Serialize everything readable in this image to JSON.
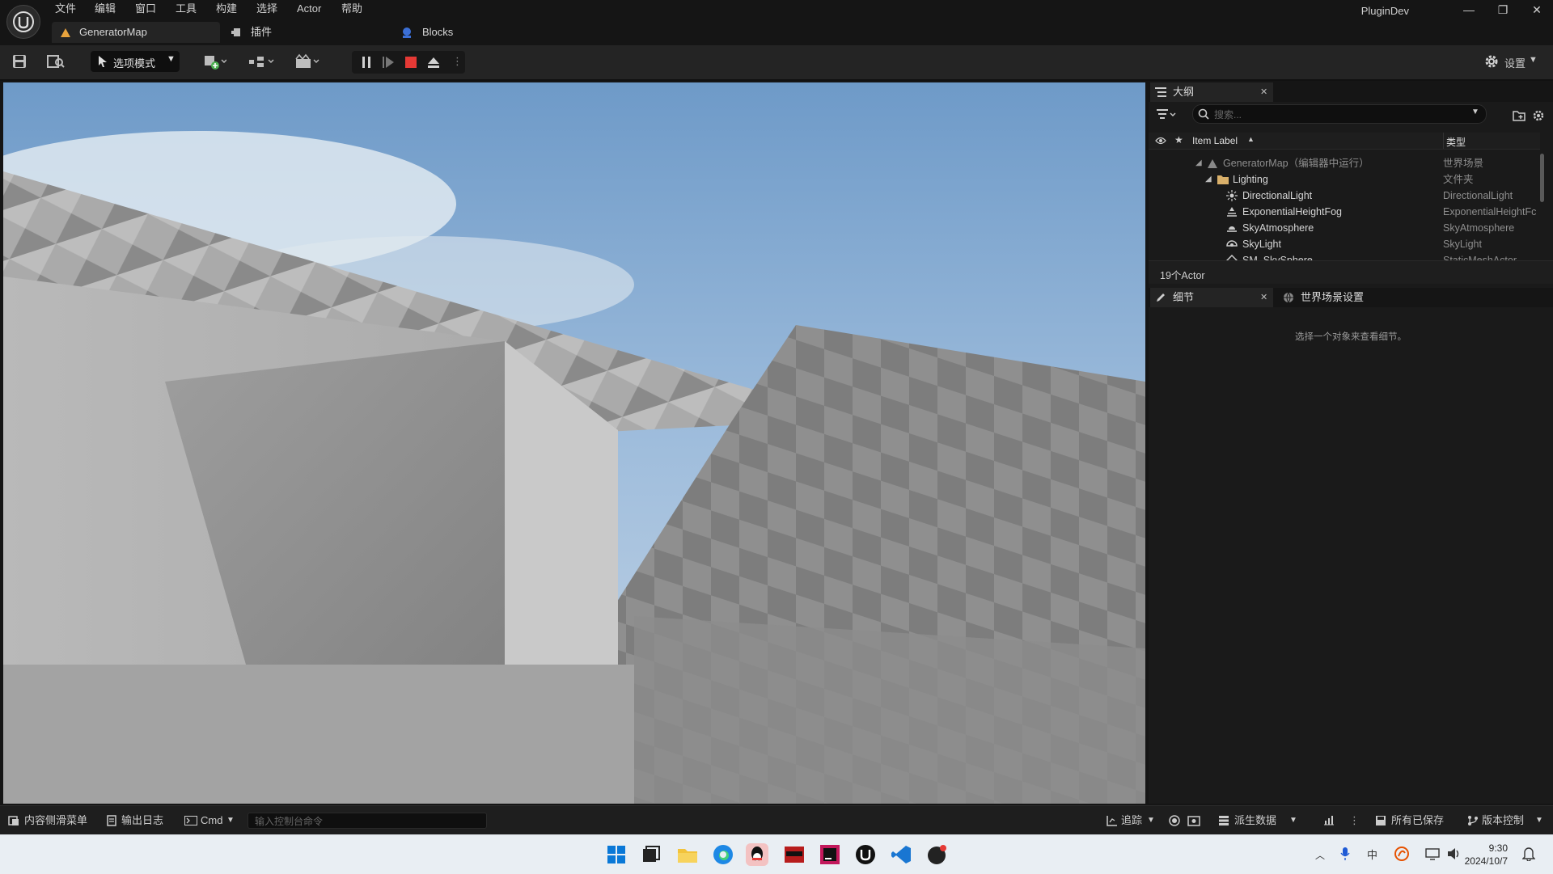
{
  "menu": [
    "文件",
    "编辑",
    "窗口",
    "工具",
    "构建",
    "选择",
    "Actor",
    "帮助"
  ],
  "tabs": {
    "main": "GeneratorMap",
    "plugins": "插件",
    "blocks": "Blocks"
  },
  "project_name": "PluginDev",
  "toolbar": {
    "mode_label": "选项模式",
    "settings_label": "设置"
  },
  "outliner": {
    "title": "大纲",
    "search_placeholder": "搜索...",
    "col_label": "Item Label",
    "col_type": "类型",
    "rows": [
      {
        "label": "GeneratorMap（编辑器中运行）",
        "type": "世界场景",
        "icon": "world-icon"
      },
      {
        "label": "Lighting",
        "type": "文件夹",
        "icon": "folder-icon"
      },
      {
        "label": "DirectionalLight",
        "type": "DirectionalLight",
        "icon": "sun-icon"
      },
      {
        "label": "ExponentialHeightFog",
        "type": "ExponentialHeightFc",
        "icon": "fog-icon"
      },
      {
        "label": "SkyAtmosphere",
        "type": "SkyAtmosphere",
        "icon": "atmosphere-icon"
      },
      {
        "label": "SkyLight",
        "type": "SkyLight",
        "icon": "skylight-icon"
      },
      {
        "label": "SM_SkySphere",
        "type": "StaticMeshActor",
        "icon": "mesh-icon"
      }
    ],
    "actor_count": "19个Actor"
  },
  "details": {
    "tab_details": "细节",
    "tab_world": "世界场景设置",
    "empty_hint": "选择一个对象来查看细节。"
  },
  "statusbar": {
    "content_drawer": "内容侧滑菜单",
    "output_log": "输出日志",
    "cmd": "Cmd",
    "console_placeholder": "输入控制台命令",
    "trace": "追踪",
    "derived_data": "派生数据",
    "all_saved": "所有已保存",
    "source_control": "版本控制"
  },
  "taskbar": {
    "time": "9:30",
    "date": "2024/10/7"
  },
  "colors": {
    "accent": "#e8a33d",
    "stop": "#e53935",
    "panel": "#1a1a1a",
    "toolbar": "#242424"
  }
}
